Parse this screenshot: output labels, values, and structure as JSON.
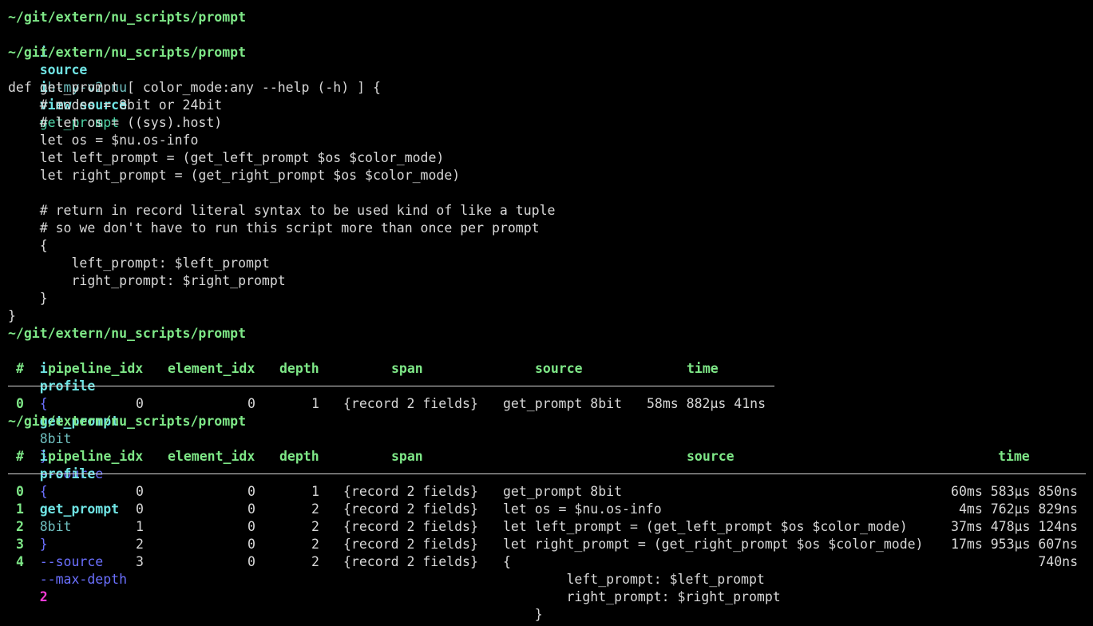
{
  "terminal": {
    "cwd": "~/git/extern/nu_scripts/prompt",
    "colors": {
      "background": "#000000",
      "path": "#7ee787",
      "text": "#d8d8d8",
      "keyword": "#6fe3e3",
      "flag": "#6b70ff",
      "number": "#ff3bd8"
    },
    "commands": [
      {
        "prompt": "~/git/extern/nu_scripts/prompt",
        "tokens": [
          "i",
          "source",
          "oh-my-v2.nu"
        ]
      },
      {
        "prompt": "~/git/extern/nu_scripts/prompt",
        "tokens": [
          "i",
          "view source",
          "get_prompt"
        ]
      },
      {
        "prompt": "~/git/extern/nu_scripts/prompt",
        "tokens": [
          "i",
          "profile",
          "{",
          "get_prompt",
          "8bit",
          "}",
          "--source"
        ]
      },
      {
        "prompt": "~/git/extern/nu_scripts/prompt",
        "tokens": [
          "i",
          "profile",
          "{",
          "get_prompt",
          "8bit",
          "}",
          "--source",
          "--max-depth",
          "2"
        ]
      }
    ],
    "source_listing": [
      "def get_prompt [ color_mode:any --help (-h) ] {",
      "    # modes = 8bit or 24bit",
      "    # let os = ((sys).host)",
      "    let os = $nu.os-info",
      "    let left_prompt = (get_left_prompt $os $color_mode)",
      "    let right_prompt = (get_right_prompt $os $color_mode)",
      "",
      "    # return in record literal syntax to be used kind of like a tuple",
      "    # so we don't have to run this script more than once per prompt",
      "    {",
      "        left_prompt: $left_prompt",
      "        right_prompt: $right_prompt",
      "    }",
      "}"
    ],
    "table1": {
      "headers": [
        "#",
        "pipeline_idx",
        "element_idx",
        "depth",
        "span",
        "source",
        "time"
      ],
      "rows": [
        {
          "index": "0",
          "pipeline_idx": "0",
          "element_idx": "0",
          "depth": "1",
          "span": "{record 2 fields}",
          "source": "get_prompt 8bit",
          "time": "58ms 882µs 41ns"
        }
      ]
    },
    "table2": {
      "headers": [
        "#",
        "pipeline_idx",
        "element_idx",
        "depth",
        "span",
        "source",
        "time"
      ],
      "rows": [
        {
          "index": "0",
          "pipeline_idx": "0",
          "element_idx": "0",
          "depth": "1",
          "span": "{record 2 fields}",
          "source": "get_prompt 8bit",
          "time": "60ms 583µs 850ns"
        },
        {
          "index": "1",
          "pipeline_idx": "0",
          "element_idx": "0",
          "depth": "2",
          "span": "{record 2 fields}",
          "source": "let os = $nu.os-info",
          "time": "4ms 762µs 829ns"
        },
        {
          "index": "2",
          "pipeline_idx": "1",
          "element_idx": "0",
          "depth": "2",
          "span": "{record 2 fields}",
          "source": "let left_prompt = (get_left_prompt $os $color_mode)",
          "time": "37ms 478µs 124ns"
        },
        {
          "index": "3",
          "pipeline_idx": "2",
          "element_idx": "0",
          "depth": "2",
          "span": "{record 2 fields}",
          "source": "let right_prompt = (get_right_prompt $os $color_mode)",
          "time": "17ms 953µs 607ns"
        },
        {
          "index": "4",
          "pipeline_idx": "3",
          "element_idx": "0",
          "depth": "2",
          "span": "{record 2 fields}",
          "source": "{",
          "time": "740ns"
        }
      ],
      "continuation": [
        "        left_prompt: $left_prompt",
        "        right_prompt: $right_prompt",
        "    }"
      ]
    }
  }
}
